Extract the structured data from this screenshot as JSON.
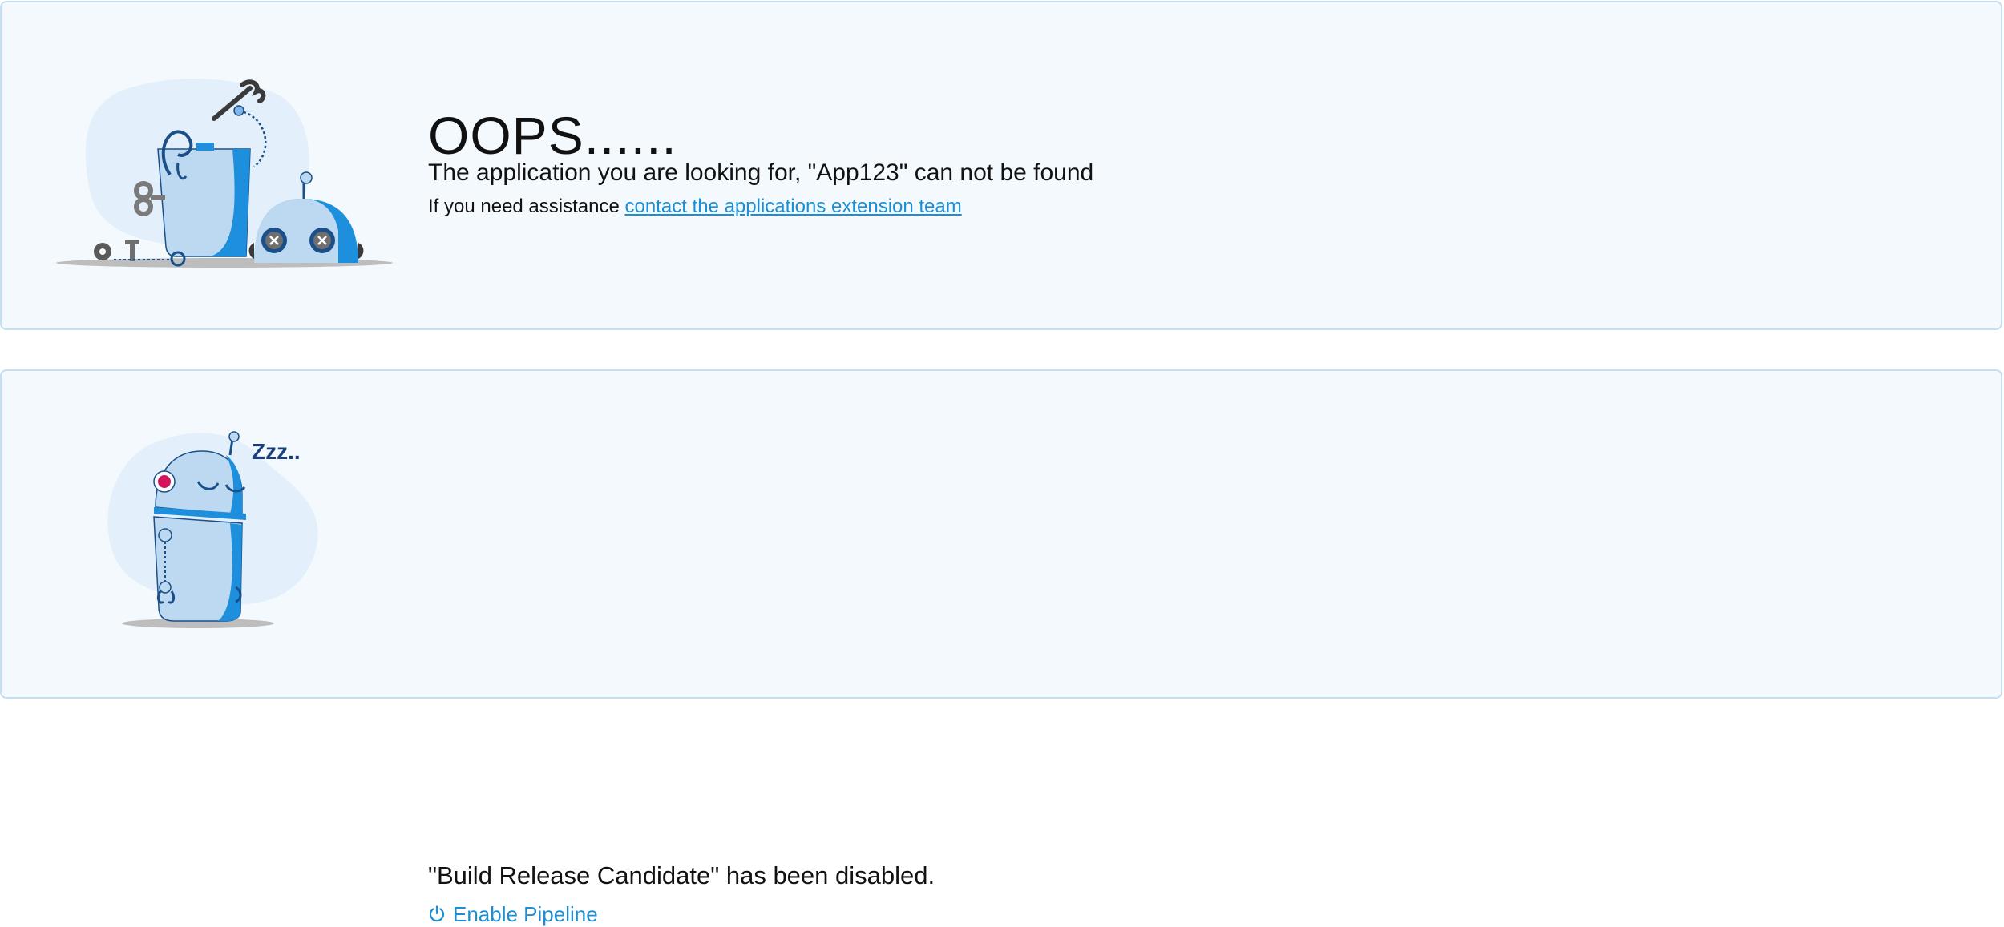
{
  "not_found": {
    "title": "OOPS......",
    "message": "The application you are looking for, \"App123\" can not be found",
    "assist_prefix": "If you need assistance ",
    "assist_link": "contact the applications extension team",
    "illustration_icon": "broken-robot-icon"
  },
  "disabled": {
    "message": "\"Build Release Candidate\" has been disabled.",
    "enable_label": "Enable Pipeline",
    "enable_icon": "power-icon",
    "sleep_text": "Zzz..",
    "illustration_icon": "sleeping-robot-icon"
  },
  "colors": {
    "panel_bg": "#f4f9fe",
    "panel_border": "#c5def0",
    "link": "#1c8fd4",
    "robot_body": "#bcd9f1",
    "robot_accent": "#1d8fdc",
    "robot_dark": "#1a4f8a",
    "eye_magenta": "#d4145a"
  }
}
